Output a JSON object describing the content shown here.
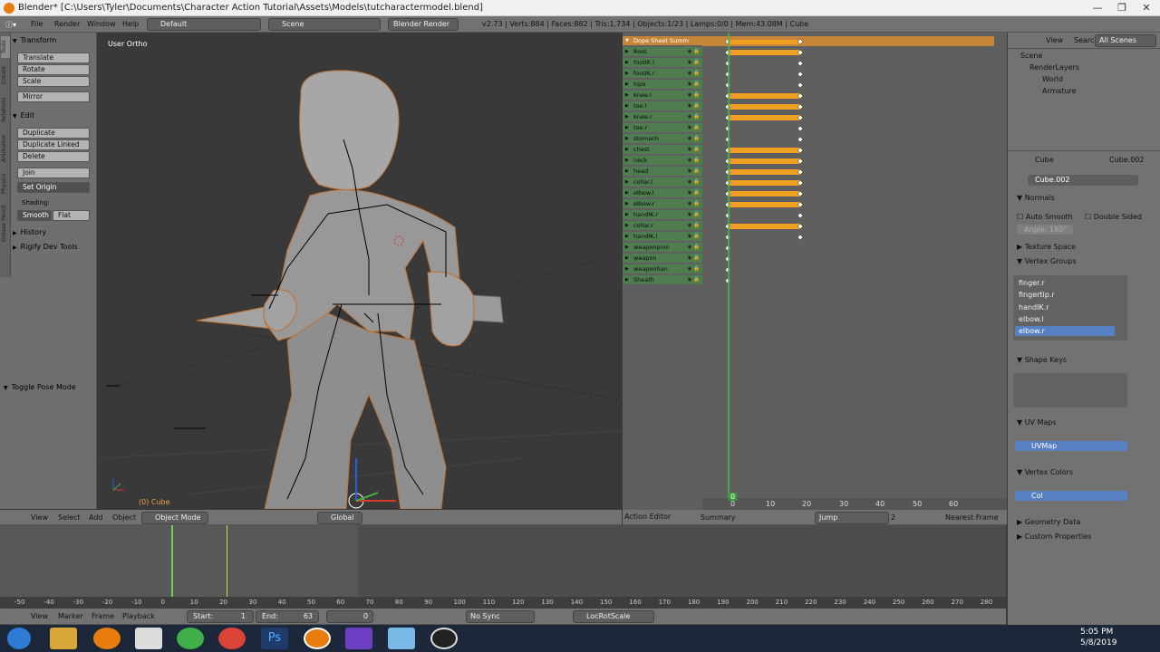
{
  "window": {
    "title": "Blender* [C:\\Users\\Tyler\\Documents\\Character Action Tutorial\\Assets\\Models\\tutcharactermodel.blend]"
  },
  "menu": {
    "items": [
      "File",
      "Render",
      "Window",
      "Help"
    ],
    "layout": "Default",
    "scene": "Scene",
    "engine": "Blender Render",
    "stats": "v2.73 | Verts:884 | Faces:882 | Tris:1,734 | Objects:1/23 | Lamps:0/0 | Mem:43.08M | Cube"
  },
  "tools": {
    "transform": "Transform",
    "translate": "Translate",
    "rotate": "Rotate",
    "scale": "Scale",
    "mirror": "Mirror",
    "edit": "Edit",
    "duplicate": "Duplicate",
    "duplicate_linked": "Duplicate Linked",
    "delete": "Delete",
    "join": "Join",
    "set_origin": "Set Origin",
    "shading": "Shading:",
    "smooth": "Smooth",
    "flat": "Flat",
    "history": "History",
    "rigify": "Rigify Dev Tools",
    "toggle_pose": "Toggle Pose Mode",
    "vtabs": [
      "Tools",
      "Create",
      "Relations",
      "Animation",
      "Physics",
      "Grease Pencil"
    ]
  },
  "viewport": {
    "label": "User Ortho",
    "object_label": "(0) Cube"
  },
  "dopesheet": {
    "summary": "Dope Sheet Summ",
    "channels": [
      "Root",
      "footIK.l",
      "footIK.r",
      "hips",
      "knee.l",
      "toe.l",
      "knee.r",
      "toe.r",
      "stomach",
      "chest",
      "neck",
      "head",
      "collar.l",
      "elbow.l",
      "elbow.r",
      "handIK.r",
      "collar.r",
      "handIK.l",
      "weaponpivo",
      "weapon",
      "weaponhan",
      "Sheath"
    ],
    "ruler": [
      "0",
      "10",
      "20",
      "30",
      "40",
      "50",
      "60"
    ],
    "current_frame": "0"
  },
  "outliner": {
    "view": "View",
    "search": "Search",
    "filter": "All Scenes",
    "items": [
      "Scene",
      "RenderLayers",
      "World",
      "Armature"
    ]
  },
  "properties": {
    "object": "Cube",
    "mesh": "Cube.002",
    "mesh_field": "Cube.002",
    "normals": "Normals",
    "auto_smooth": "Auto Smooth",
    "double_sided": "Double Sided",
    "angle": "Angle: 180°",
    "texture_space": "Texture Space",
    "vertex_groups": "Vertex Groups",
    "groups": [
      "finger.r",
      "fingertip.r",
      "handIK.r",
      "elbow.l",
      "elbow.r"
    ],
    "shape_keys": "Shape Keys",
    "uv_maps": "UV Maps",
    "uvmap": "UVMap",
    "vertex_colors": "Vertex Colors",
    "col": "Col",
    "geometry_data": "Geometry Data",
    "custom_properties": "Custom Properties"
  },
  "view3d_header": {
    "view": "View",
    "select": "Select",
    "add": "Add",
    "object": "Object",
    "mode": "Object Mode",
    "orientation": "Global"
  },
  "dope_header": {
    "editor": "Action Editor",
    "summary": "Summary",
    "jump": "Jump",
    "num": "2",
    "snap": "Nearest Frame"
  },
  "timeline_ruler": [
    "-50",
    "-40",
    "-30",
    "-20",
    "-10",
    "0",
    "10",
    "20",
    "30",
    "40",
    "50",
    "60",
    "70",
    "80",
    "90",
    "100",
    "110",
    "120",
    "130",
    "140",
    "150",
    "160",
    "170",
    "180",
    "190",
    "200",
    "210",
    "220",
    "230",
    "240",
    "250",
    "260",
    "270",
    "280"
  ],
  "timeline_header": {
    "view": "View",
    "marker": "Marker",
    "frame": "Frame",
    "playback": "Playback",
    "start": "Start:",
    "start_val": "1",
    "end": "End:",
    "end_val": "63",
    "current": "0",
    "sync": "No Sync",
    "keying": "LocRotScale"
  },
  "clock": {
    "time": "5:05 PM",
    "date": "5/8/2019"
  }
}
